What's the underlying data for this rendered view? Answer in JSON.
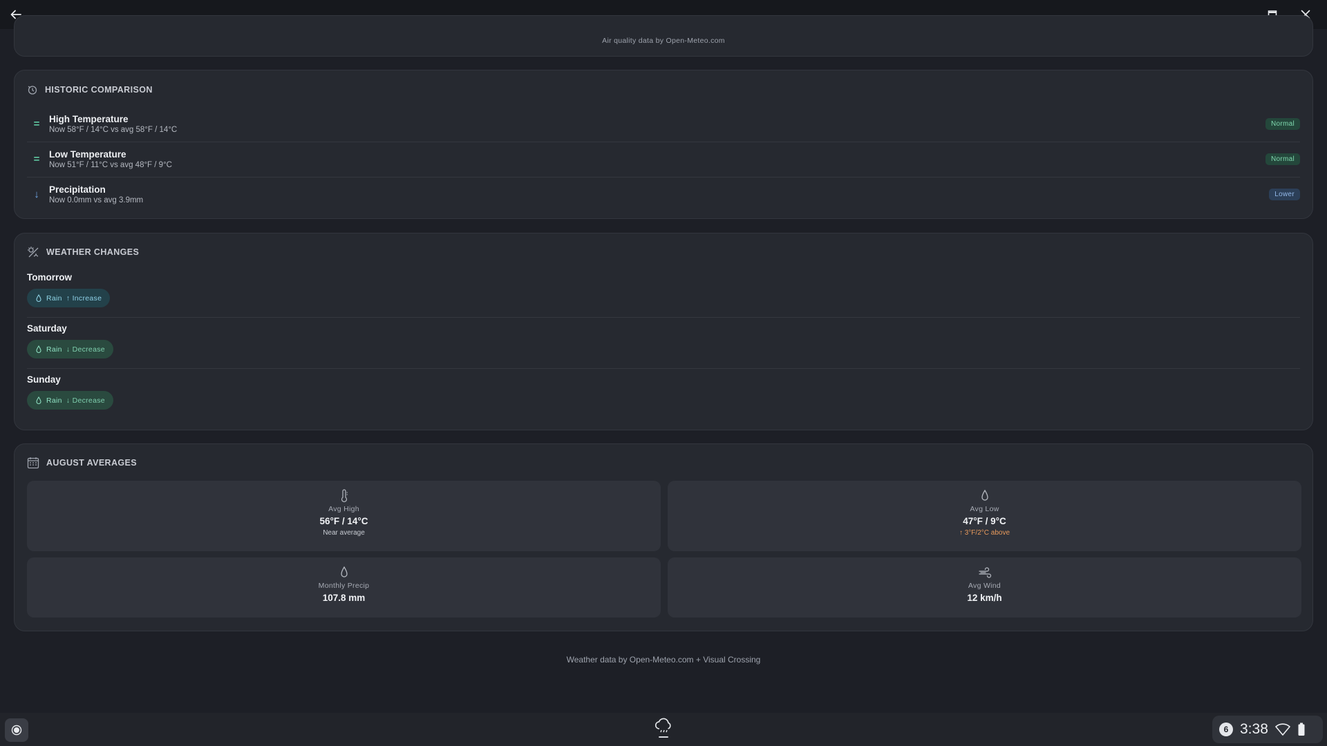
{
  "air_quality": {
    "attribution": "Air quality data by Open-Meteo.com"
  },
  "historic": {
    "title": "HISTORIC COMPARISON",
    "rows": [
      {
        "marker": "=",
        "title": "High Temperature",
        "detail": "Now 58°F / 14°C vs avg 58°F / 14°C",
        "badge": "Normal"
      },
      {
        "marker": "=",
        "title": "Low Temperature",
        "detail": "Now 51°F / 11°C vs avg 48°F / 9°C",
        "badge": "Normal"
      },
      {
        "marker": "↓",
        "title": "Precipitation",
        "detail": "Now 0.0mm vs avg 3.9mm",
        "badge": "Lower"
      }
    ]
  },
  "weather_changes": {
    "title": "WEATHER CHANGES",
    "days": [
      {
        "day": "Tomorrow",
        "type": "Rain",
        "change": "↑ Increase"
      },
      {
        "day": "Saturday",
        "type": "Rain",
        "change": "↓ Decrease"
      },
      {
        "day": "Sunday",
        "type": "Rain",
        "change": "↓ Decrease"
      }
    ]
  },
  "august": {
    "title": "AUGUST AVERAGES",
    "tiles": [
      {
        "icon": "thermometer-icon",
        "label": "Avg High",
        "value": "56°F / 14°C",
        "note": "Near average"
      },
      {
        "icon": "droplet-icon",
        "label": "Avg Low",
        "value": "47°F / 9°C",
        "note": "↑ 3°F/2°C above"
      },
      {
        "icon": "droplet-icon",
        "label": "Monthly Precip",
        "value": "107.8 mm"
      },
      {
        "icon": "wind-icon",
        "label": "Avg Wind",
        "value": "12 km/h"
      }
    ]
  },
  "footer": "Weather data by Open-Meteo.com + Visual Crossing",
  "shelf": {
    "notification_count": "6",
    "time": "3:38"
  },
  "colors": {
    "background": "#1d1f26",
    "card": "#262930",
    "normal_badge": "#24473b",
    "lower_badge": "#2c3f58",
    "warm_note": "#e89a5c"
  }
}
